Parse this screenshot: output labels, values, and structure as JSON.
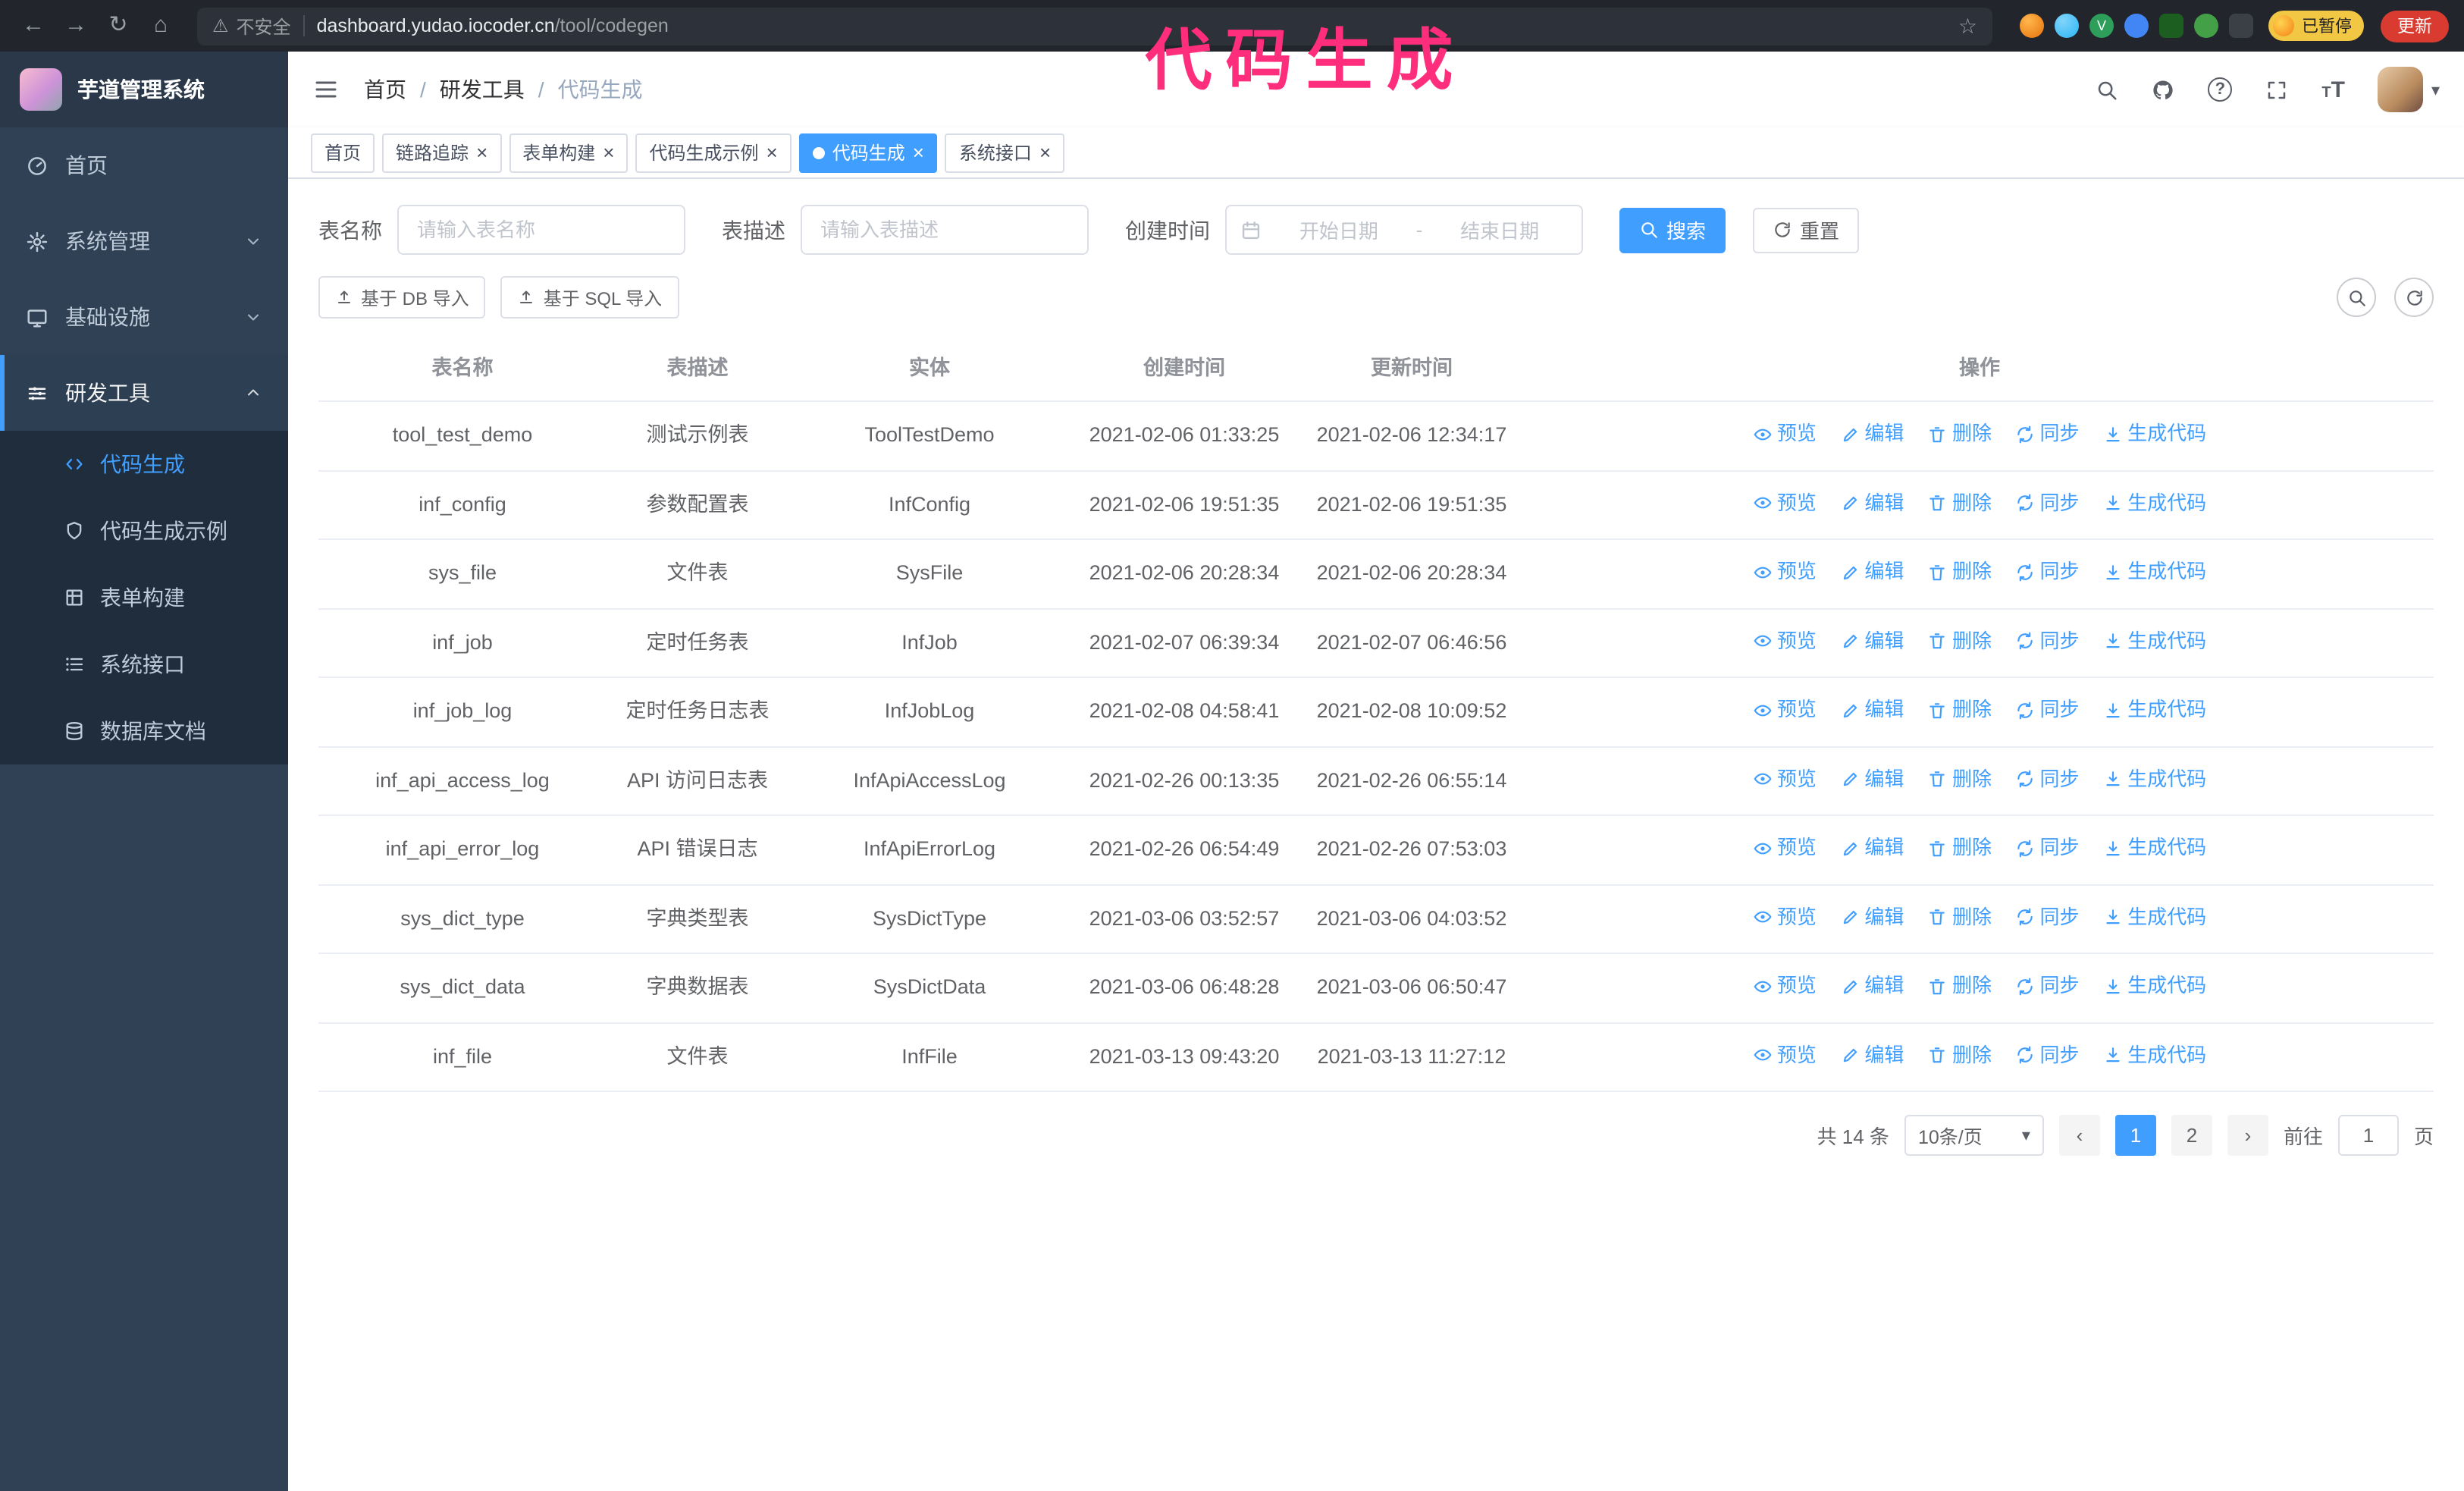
{
  "icons": {
    "back": "←",
    "forward": "→",
    "reload": "↻",
    "home": "⌂",
    "star": "☆",
    "warning": "⚠",
    "close": "×",
    "caret_down": "▾",
    "prev": "‹",
    "next": "›",
    "question": "?",
    "font_small": "T",
    "font_big": "T",
    "ext_v": "V"
  },
  "annotation": "代码生成",
  "browser": {
    "warning_text": "不安全",
    "url_host": "dashboard.yudao.iocoder.cn",
    "url_path": "/tool/codegen",
    "paused_badge": "已暂停",
    "update_button": "更新"
  },
  "sidebar": {
    "logo_title": "芋道管理系统",
    "items": [
      {
        "label": "首页"
      },
      {
        "label": "系统管理"
      },
      {
        "label": "基础设施"
      },
      {
        "label": "研发工具"
      }
    ],
    "subitems": [
      {
        "label": "代码生成"
      },
      {
        "label": "代码生成示例"
      },
      {
        "label": "表单构建"
      },
      {
        "label": "系统接口"
      },
      {
        "label": "数据库文档"
      }
    ]
  },
  "header": {
    "breadcrumb": [
      "首页",
      "研发工具",
      "代码生成"
    ],
    "separator": "/"
  },
  "tabs": [
    {
      "label": "首页",
      "closable": false,
      "active": false
    },
    {
      "label": "链路追踪",
      "closable": true,
      "active": false
    },
    {
      "label": "表单构建",
      "closable": true,
      "active": false
    },
    {
      "label": "代码生成示例",
      "closable": true,
      "active": false
    },
    {
      "label": "代码生成",
      "closable": true,
      "active": true
    },
    {
      "label": "系统接口",
      "closable": true,
      "active": false
    }
  ],
  "filters": {
    "table_name_label": "表名称",
    "table_name_placeholder": "请输入表名称",
    "table_desc_label": "表描述",
    "table_desc_placeholder": "请输入表描述",
    "create_time_label": "创建时间",
    "date_start_placeholder": "开始日期",
    "date_separator": "-",
    "date_end_placeholder": "结束日期",
    "search_button": "搜索",
    "reset_button": "重置"
  },
  "toolbar": {
    "import_db": "基于 DB 导入",
    "import_sql": "基于 SQL 导入"
  },
  "table": {
    "columns": [
      "表名称",
      "表描述",
      "实体",
      "创建时间",
      "更新时间",
      "操作"
    ],
    "actions": [
      "预览",
      "编辑",
      "删除",
      "同步",
      "生成代码"
    ],
    "rows": [
      {
        "name": "tool_test_demo",
        "desc": "测试示例表",
        "entity": "ToolTestDemo",
        "created": "2021-02-06 01:33:25",
        "updated": "2021-02-06 12:34:17"
      },
      {
        "name": "inf_config",
        "desc": "参数配置表",
        "entity": "InfConfig",
        "created": "2021-02-06 19:51:35",
        "updated": "2021-02-06 19:51:35"
      },
      {
        "name": "sys_file",
        "desc": "文件表",
        "entity": "SysFile",
        "created": "2021-02-06 20:28:34",
        "updated": "2021-02-06 20:28:34"
      },
      {
        "name": "inf_job",
        "desc": "定时任务表",
        "entity": "InfJob",
        "created": "2021-02-07 06:39:34",
        "updated": "2021-02-07 06:46:56"
      },
      {
        "name": "inf_job_log",
        "desc": "定时任务日志表",
        "entity": "InfJobLog",
        "created": "2021-02-08 04:58:41",
        "updated": "2021-02-08 10:09:52"
      },
      {
        "name": "inf_api_access_log",
        "desc": "API 访问日志表",
        "entity": "InfApiAccessLog",
        "created": "2021-02-26 00:13:35",
        "updated": "2021-02-26 06:55:14"
      },
      {
        "name": "inf_api_error_log",
        "desc": "API 错误日志",
        "entity": "InfApiErrorLog",
        "created": "2021-02-26 06:54:49",
        "updated": "2021-02-26 07:53:03"
      },
      {
        "name": "sys_dict_type",
        "desc": "字典类型表",
        "entity": "SysDictType",
        "created": "2021-03-06 03:52:57",
        "updated": "2021-03-06 04:03:52"
      },
      {
        "name": "sys_dict_data",
        "desc": "字典数据表",
        "entity": "SysDictData",
        "created": "2021-03-06 06:48:28",
        "updated": "2021-03-06 06:50:47"
      },
      {
        "name": "inf_file",
        "desc": "文件表",
        "entity": "InfFile",
        "created": "2021-03-13 09:43:20",
        "updated": "2021-03-13 11:27:12"
      }
    ]
  },
  "pagination": {
    "total": "共 14 条",
    "page_size": "10条/页",
    "pages": [
      "1",
      "2"
    ],
    "goto_label": "前往",
    "goto_value": "1",
    "goto_suffix": "页"
  },
  "colors": {
    "accent": "#409eff",
    "annotation": "#ff2e7c",
    "sidebar_bg": "#304156",
    "submenu_bg": "#1f2d3d"
  }
}
